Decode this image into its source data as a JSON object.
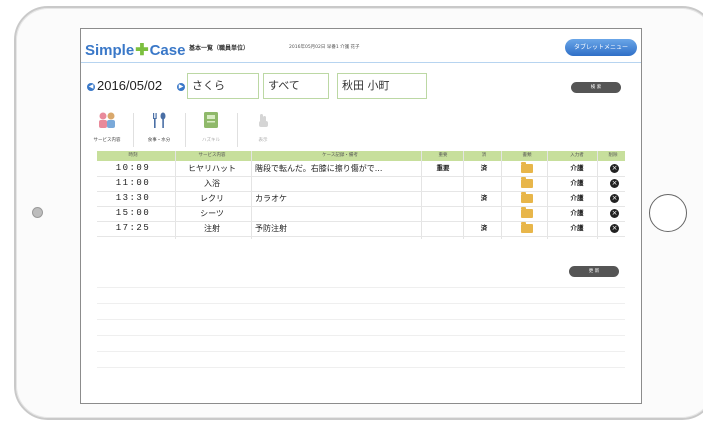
{
  "app": {
    "logo_simple": "Simple",
    "logo_plus": "✚",
    "logo_case": "Case",
    "page_title": "基本一覧（職員単位）",
    "header_info": "2016年05月02日 早番1 介護 花子",
    "tablet_menu_label": "タブレットメニュー"
  },
  "filters": {
    "prev_icon": "arrow-left-icon",
    "date": "2016/05/02",
    "unit": "さくら",
    "category": "すべて",
    "resident": "秋田 小町",
    "search_label": "検 索"
  },
  "toolbar": {
    "service_input": "サービス内容",
    "meal_input": "食事・水分",
    "disabled_1": "ハズキル",
    "disabled_2": "表示"
  },
  "table": {
    "headers": [
      "時刻",
      "サービス内容",
      "ケース記録・備考",
      "重要",
      "済",
      "書類",
      "入力者",
      "削除"
    ],
    "rows": [
      {
        "time": "10:09",
        "item": "ヒヤリハット",
        "note": "階段で転んだ。右膝に擦り傷がで...",
        "important": "重要",
        "done": "済",
        "folder": true,
        "input_by": "介護"
      },
      {
        "time": "11:00",
        "item": "入浴",
        "note": "",
        "important": "",
        "done": "",
        "folder": true,
        "input_by": "介護"
      },
      {
        "time": "13:30",
        "item": "レクリ",
        "note": "カラオケ",
        "important": "",
        "done": "済",
        "folder": true,
        "input_by": "介護"
      },
      {
        "time": "15:00",
        "item": "シーツ",
        "note": "",
        "important": "",
        "done": "",
        "folder": true,
        "input_by": "介護"
      },
      {
        "time": "17:25",
        "item": "注射",
        "note": "予防注射",
        "important": "",
        "done": "済",
        "folder": true,
        "input_by": "介護"
      }
    ]
  },
  "footer": {
    "button_label": "更 新"
  },
  "colors": {
    "brand_blue": "#3a78c8",
    "brand_green": "#7cbf3f",
    "header_green": "#c7df9c",
    "folder": "#e8b64a"
  }
}
